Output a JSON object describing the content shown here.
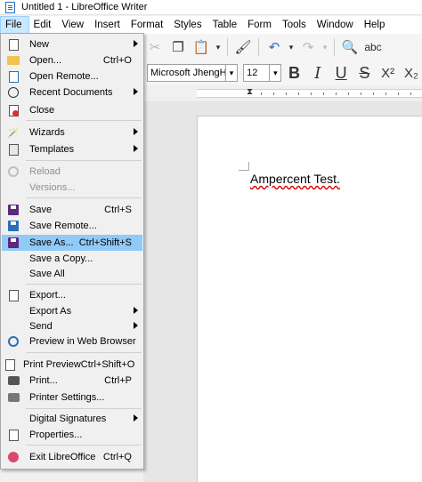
{
  "window": {
    "title": "Untitled 1 - LibreOffice Writer"
  },
  "menubar": [
    {
      "label": "File",
      "active": true
    },
    {
      "label": "Edit"
    },
    {
      "label": "View"
    },
    {
      "label": "Insert"
    },
    {
      "label": "Format"
    },
    {
      "label": "Styles"
    },
    {
      "label": "Table"
    },
    {
      "label": "Form"
    },
    {
      "label": "Tools"
    },
    {
      "label": "Window"
    },
    {
      "label": "Help"
    }
  ],
  "toolbar": {
    "font_name": "Microsoft JhengHei",
    "font_size": "12",
    "bold": "B",
    "italic": "I",
    "underline": "U",
    "strike": "S",
    "superscript": "X²",
    "subscript": "X₂"
  },
  "file_menu": {
    "items": [
      {
        "label": "New",
        "shortcut": "",
        "icon": "new-document-icon",
        "submenu": true
      },
      {
        "label": "Open...",
        "shortcut": "Ctrl+O",
        "icon": "open-folder-icon"
      },
      {
        "label": "Open Remote...",
        "shortcut": "",
        "icon": "open-remote-icon"
      },
      {
        "label": "Recent Documents",
        "shortcut": "",
        "icon": "recent-documents-icon",
        "submenu": true
      },
      {
        "label": "Close",
        "shortcut": "",
        "icon": "close-document-icon"
      },
      {
        "label": "Wizards",
        "shortcut": "",
        "icon": "wizard-icon",
        "submenu": true
      },
      {
        "label": "Templates",
        "shortcut": "",
        "icon": "templates-icon",
        "submenu": true
      },
      {
        "label": "Reload",
        "shortcut": "",
        "icon": "reload-icon",
        "disabled": true
      },
      {
        "label": "Versions...",
        "shortcut": "",
        "icon": "",
        "disabled": true
      },
      {
        "label": "Save",
        "shortcut": "Ctrl+S",
        "icon": "save-icon"
      },
      {
        "label": "Save Remote...",
        "shortcut": "",
        "icon": "save-remote-icon"
      },
      {
        "label": "Save As...",
        "shortcut": "Ctrl+Shift+S",
        "icon": "save-as-icon",
        "highlighted": true
      },
      {
        "label": "Save a Copy...",
        "shortcut": "",
        "icon": ""
      },
      {
        "label": "Save All",
        "shortcut": "",
        "icon": ""
      },
      {
        "label": "Export...",
        "shortcut": "",
        "icon": "export-icon"
      },
      {
        "label": "Export As",
        "shortcut": "",
        "icon": "",
        "submenu": true
      },
      {
        "label": "Send",
        "shortcut": "",
        "icon": "",
        "submenu": true
      },
      {
        "label": "Preview in Web Browser",
        "shortcut": "",
        "icon": "web-browser-icon"
      },
      {
        "label": "Print Preview",
        "shortcut": "Ctrl+Shift+O",
        "icon": "print-preview-icon"
      },
      {
        "label": "Print...",
        "shortcut": "Ctrl+P",
        "icon": "print-icon"
      },
      {
        "label": "Printer Settings...",
        "shortcut": "",
        "icon": "printer-settings-icon"
      },
      {
        "label": "Digital Signatures",
        "shortcut": "",
        "icon": "",
        "submenu": true
      },
      {
        "label": "Properties...",
        "shortcut": "",
        "icon": "properties-icon"
      },
      {
        "label": "Exit LibreOffice",
        "shortcut": "Ctrl+Q",
        "icon": "exit-icon"
      }
    ]
  },
  "document": {
    "text": "Ampercent Test."
  }
}
